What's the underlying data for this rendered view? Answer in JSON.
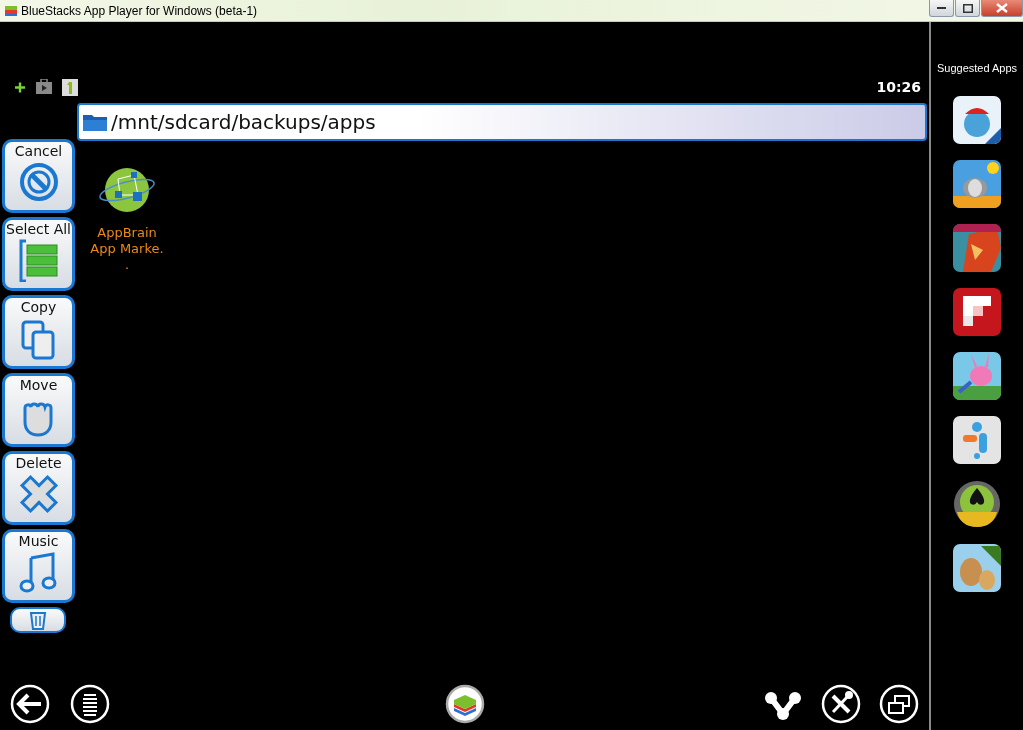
{
  "window": {
    "title": "BlueStacks App Player for Windows (beta-1)"
  },
  "status_bar": {
    "icons": [
      {
        "kind": "plus"
      },
      {
        "kind": "bag"
      },
      {
        "kind": "one"
      }
    ],
    "time": "10:26"
  },
  "path": "/mnt/sdcard/backups/apps",
  "actions": [
    {
      "kind": "cancel",
      "label": "Cancel"
    },
    {
      "kind": "select-all",
      "label": "Select All"
    },
    {
      "kind": "copy",
      "label": "Copy"
    },
    {
      "kind": "move",
      "label": "Move"
    },
    {
      "kind": "delete",
      "label": "Delete"
    },
    {
      "kind": "music",
      "label": "Music"
    },
    {
      "kind": "trash"
    }
  ],
  "files": [
    {
      "lines": [
        "AppBrain",
        "App Marke.",
        "."
      ]
    }
  ],
  "sidebar": {
    "title": "Suggested Apps"
  },
  "nav": {
    "left": [
      {
        "kind": "back"
      },
      {
        "kind": "menu"
      }
    ],
    "center": [
      {
        "kind": "home"
      }
    ],
    "right": [
      {
        "kind": "share"
      },
      {
        "kind": "settings"
      },
      {
        "kind": "window"
      }
    ]
  }
}
